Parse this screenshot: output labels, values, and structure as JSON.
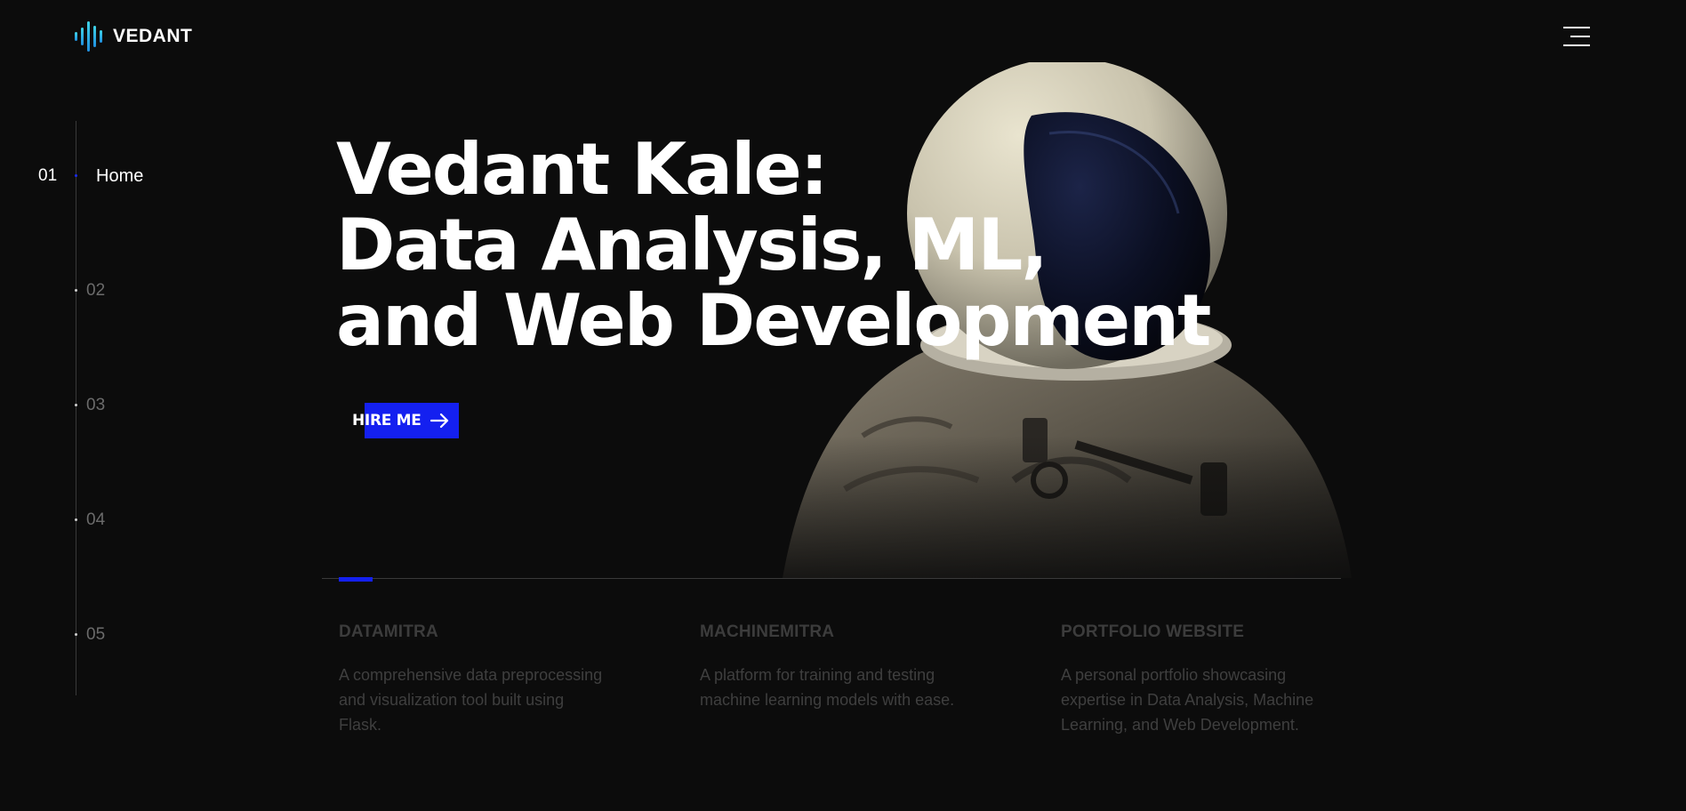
{
  "brand": {
    "name": "VEDANT",
    "logo_icon": "sound-wave-icon",
    "accent_color": "#1420f0",
    "logo_color": "#2fb8e6"
  },
  "header": {
    "menu_icon": "hamburger-menu-icon"
  },
  "side_nav": {
    "items": [
      {
        "number": "01",
        "label": "Home",
        "active": true
      },
      {
        "number": "02"
      },
      {
        "number": "03"
      },
      {
        "number": "04"
      },
      {
        "number": "05"
      }
    ]
  },
  "hero": {
    "title_lines": [
      "Vedant Kale:",
      "Data Analysis, ML,",
      "and Web Development"
    ],
    "cta_label": "HIRE ME",
    "cta_icon": "arrow-right-icon",
    "image": "astronaut-helmet-image"
  },
  "projects": [
    {
      "title": "DATAMITRA",
      "description": "A comprehensive data preprocessing and visualization tool built using Flask."
    },
    {
      "title": "MACHINEMITRA",
      "description": "A platform for training and testing machine learning models with ease."
    },
    {
      "title": "PORTFOLIO WEBSITE",
      "description": "A personal portfolio showcasing expertise in Data Analysis, Machine Learning, and Web Development."
    }
  ]
}
